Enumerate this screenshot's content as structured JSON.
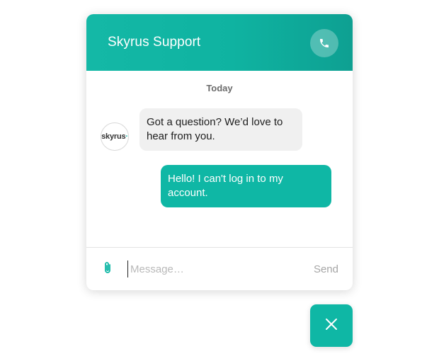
{
  "header": {
    "title": "Skyrus Support",
    "call_icon": "phone-icon"
  },
  "conversation": {
    "day_label": "Today",
    "agent_avatar": {
      "text": "skyrus",
      "dot": "·"
    },
    "messages": [
      {
        "sender": "agent",
        "text": "Got a question? We’d love to hear from you."
      },
      {
        "sender": "user",
        "text": "Hello! I can't log in to my account."
      }
    ]
  },
  "composer": {
    "attach_icon": "paperclip-icon",
    "placeholder": "Message…",
    "value": "",
    "send_label": "Send"
  },
  "launcher": {
    "close_icon": "close-icon"
  },
  "colors": {
    "brand": "#0fb7a5",
    "header_gradient_end": "#0ea092",
    "agent_bubble": "#f0f0f0",
    "muted_text": "#a6a6a6"
  }
}
